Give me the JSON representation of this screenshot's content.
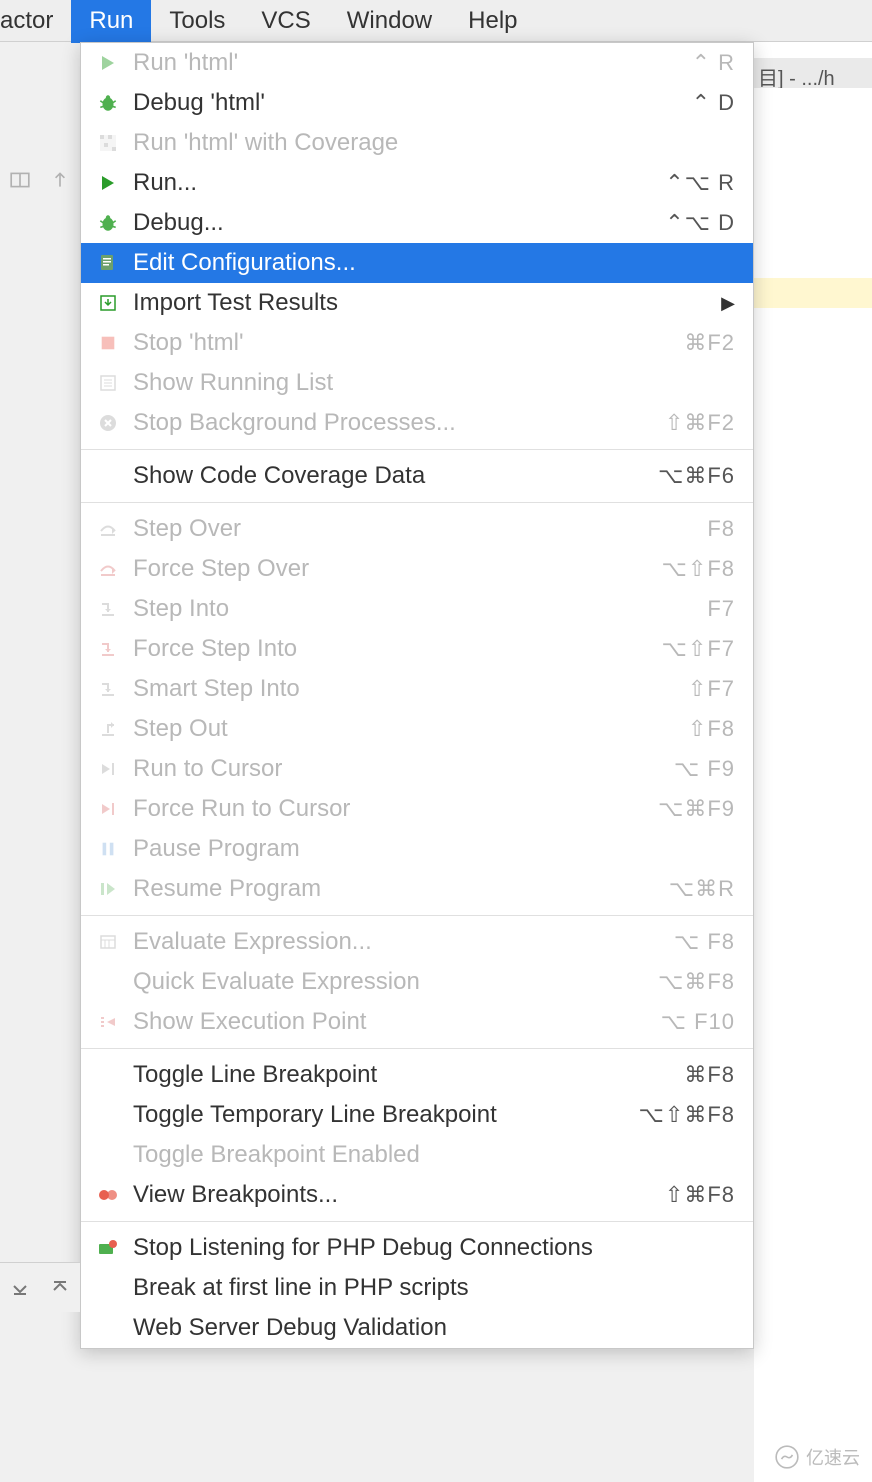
{
  "menubar": {
    "partial_item": "actor",
    "items": [
      "Run",
      "Tools",
      "VCS",
      "Window",
      "Help"
    ],
    "active_index": 0
  },
  "editor": {
    "tab_text": "目] - .../h"
  },
  "dropdown": {
    "groups": [
      [
        {
          "icon": "play-icon",
          "color": "#4fb04f",
          "label": "Run 'html'",
          "shortcut": "⌃ R",
          "disabled": true
        },
        {
          "icon": "bug-icon",
          "color": "#4fb04f",
          "label": "Debug 'html'",
          "shortcut": "⌃ D",
          "disabled": false
        },
        {
          "icon": "coverage-icon",
          "color": "#c0c0c0",
          "label": "Run 'html' with Coverage",
          "shortcut": "",
          "disabled": true
        },
        {
          "icon": "play-icon",
          "color": "#2a9c2a",
          "label": "Run...",
          "shortcut": "⌃⌥ R",
          "disabled": false
        },
        {
          "icon": "bug-icon",
          "color": "#4fb04f",
          "label": "Debug...",
          "shortcut": "⌃⌥ D",
          "disabled": false
        },
        {
          "icon": "edit-config-icon",
          "color": "#2478e5",
          "label": "Edit Configurations...",
          "shortcut": "",
          "disabled": false,
          "highlighted": true
        },
        {
          "icon": "import-icon",
          "color": "#2a9c2a",
          "label": "Import Test Results",
          "shortcut": "",
          "disabled": false,
          "submenu": true
        },
        {
          "icon": "stop-icon",
          "color": "#f28b82",
          "label": "Stop 'html'",
          "shortcut": "⌘F2",
          "disabled": true
        },
        {
          "icon": "list-icon",
          "color": "#c0c0c0",
          "label": "Show Running List",
          "shortcut": "",
          "disabled": true
        },
        {
          "icon": "stop-circle-icon",
          "color": "#c0c0c0",
          "label": "Stop Background Processes...",
          "shortcut": "⇧⌘F2",
          "disabled": true
        }
      ],
      [
        {
          "icon": "",
          "label": "Show Code Coverage Data",
          "shortcut": "⌥⌘F6",
          "disabled": false
        }
      ],
      [
        {
          "icon": "step-over-icon",
          "color": "#c0c0c0",
          "label": "Step Over",
          "shortcut": "F8",
          "disabled": true
        },
        {
          "icon": "force-step-over-icon",
          "color": "#e6a0a0",
          "label": "Force Step Over",
          "shortcut": "⌥⇧F8",
          "disabled": true
        },
        {
          "icon": "step-into-icon",
          "color": "#c0c0c0",
          "label": "Step Into",
          "shortcut": "F7",
          "disabled": true
        },
        {
          "icon": "force-step-into-icon",
          "color": "#e6a0a0",
          "label": "Force Step Into",
          "shortcut": "⌥⇧F7",
          "disabled": true
        },
        {
          "icon": "smart-step-into-icon",
          "color": "#c0c0c0",
          "label": "Smart Step Into",
          "shortcut": "⇧F7",
          "disabled": true
        },
        {
          "icon": "step-out-icon",
          "color": "#c0c0c0",
          "label": "Step Out",
          "shortcut": "⇧F8",
          "disabled": true
        },
        {
          "icon": "run-to-cursor-icon",
          "color": "#c0c0c0",
          "label": "Run to Cursor",
          "shortcut": "⌥ F9",
          "disabled": true
        },
        {
          "icon": "force-run-to-cursor-icon",
          "color": "#e6a0a0",
          "label": "Force Run to Cursor",
          "shortcut": "⌥⌘F9",
          "disabled": true
        },
        {
          "icon": "pause-icon",
          "color": "#a8c8e8",
          "label": "Pause Program",
          "shortcut": "",
          "disabled": true
        },
        {
          "icon": "resume-icon",
          "color": "#a0d0a0",
          "label": "Resume Program",
          "shortcut": "⌥⌘R",
          "disabled": true
        }
      ],
      [
        {
          "icon": "evaluate-icon",
          "color": "#c0c0c0",
          "label": "Evaluate Expression...",
          "shortcut": "⌥ F8",
          "disabled": true
        },
        {
          "icon": "",
          "label": "Quick Evaluate Expression",
          "shortcut": "⌥⌘F8",
          "disabled": true
        },
        {
          "icon": "execution-point-icon",
          "color": "#e6a0a0",
          "label": "Show Execution Point",
          "shortcut": "⌥ F10",
          "disabled": true
        }
      ],
      [
        {
          "icon": "",
          "label": "Toggle Line Breakpoint",
          "shortcut": "⌘F8",
          "disabled": false
        },
        {
          "icon": "",
          "label": "Toggle Temporary Line Breakpoint",
          "shortcut": "⌥⇧⌘F8",
          "disabled": false
        },
        {
          "icon": "",
          "label": "Toggle Breakpoint Enabled",
          "shortcut": "",
          "disabled": true
        },
        {
          "icon": "breakpoints-icon",
          "color": "#e86050",
          "label": "View Breakpoints...",
          "shortcut": "⇧⌘F8",
          "disabled": false
        }
      ],
      [
        {
          "icon": "php-debug-icon",
          "color": "#4fb04f",
          "label": "Stop Listening for PHP Debug Connections",
          "shortcut": "",
          "disabled": false
        },
        {
          "icon": "",
          "label": "Break at first line in PHP scripts",
          "shortcut": "",
          "disabled": false
        },
        {
          "icon": "",
          "label": "Web Server Debug Validation",
          "shortcut": "",
          "disabled": false
        }
      ]
    ]
  },
  "watermark": "亿速云"
}
